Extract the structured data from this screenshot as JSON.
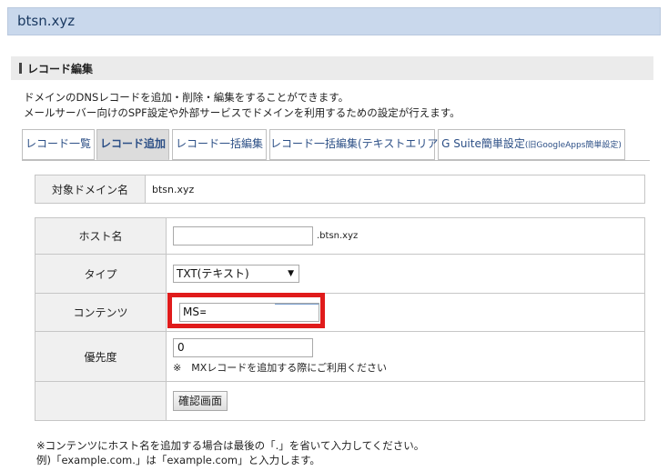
{
  "header": {
    "domain": "btsn.xyz"
  },
  "section": {
    "title": "レコード編集"
  },
  "description": [
    "ドメインのDNSレコードを追加・削除・編集をすることができます。",
    "メールサーバー向けのSPF設定や外部サービスでドメインを利用するための設定が行えます。"
  ],
  "tabs": [
    {
      "label": "レコード一覧"
    },
    {
      "label": "レコード追加"
    },
    {
      "label": "レコード一括編集"
    },
    {
      "label": "レコード一括編集(テキストエリア)"
    },
    {
      "label": "G Suite簡単設定",
      "small": "(旧GoogleApps簡単設定)"
    }
  ],
  "target": {
    "label": "対象ドメイン名",
    "value": "btsn.xyz"
  },
  "form": {
    "host": {
      "label": "ホスト名",
      "value": "",
      "suffix": ".btsn.xyz"
    },
    "type": {
      "label": "タイプ",
      "selected": "TXT(テキスト)"
    },
    "content": {
      "label": "コンテンツ",
      "value": "MS="
    },
    "priority": {
      "label": "優先度",
      "value": "0",
      "note": "※　MXレコードを追加する際にご利用ください"
    },
    "confirm_label": "確認画面"
  },
  "footer": [
    "※コンテンツにホスト名を追加する場合は最後の「.」を省いて入力してください。",
    "例)「example.com.」は「example.com」と入力します。"
  ],
  "colors": {
    "highlight": "#e01b1b",
    "header_bg": "#c9d8ec",
    "tab_text": "#2c4f86"
  }
}
